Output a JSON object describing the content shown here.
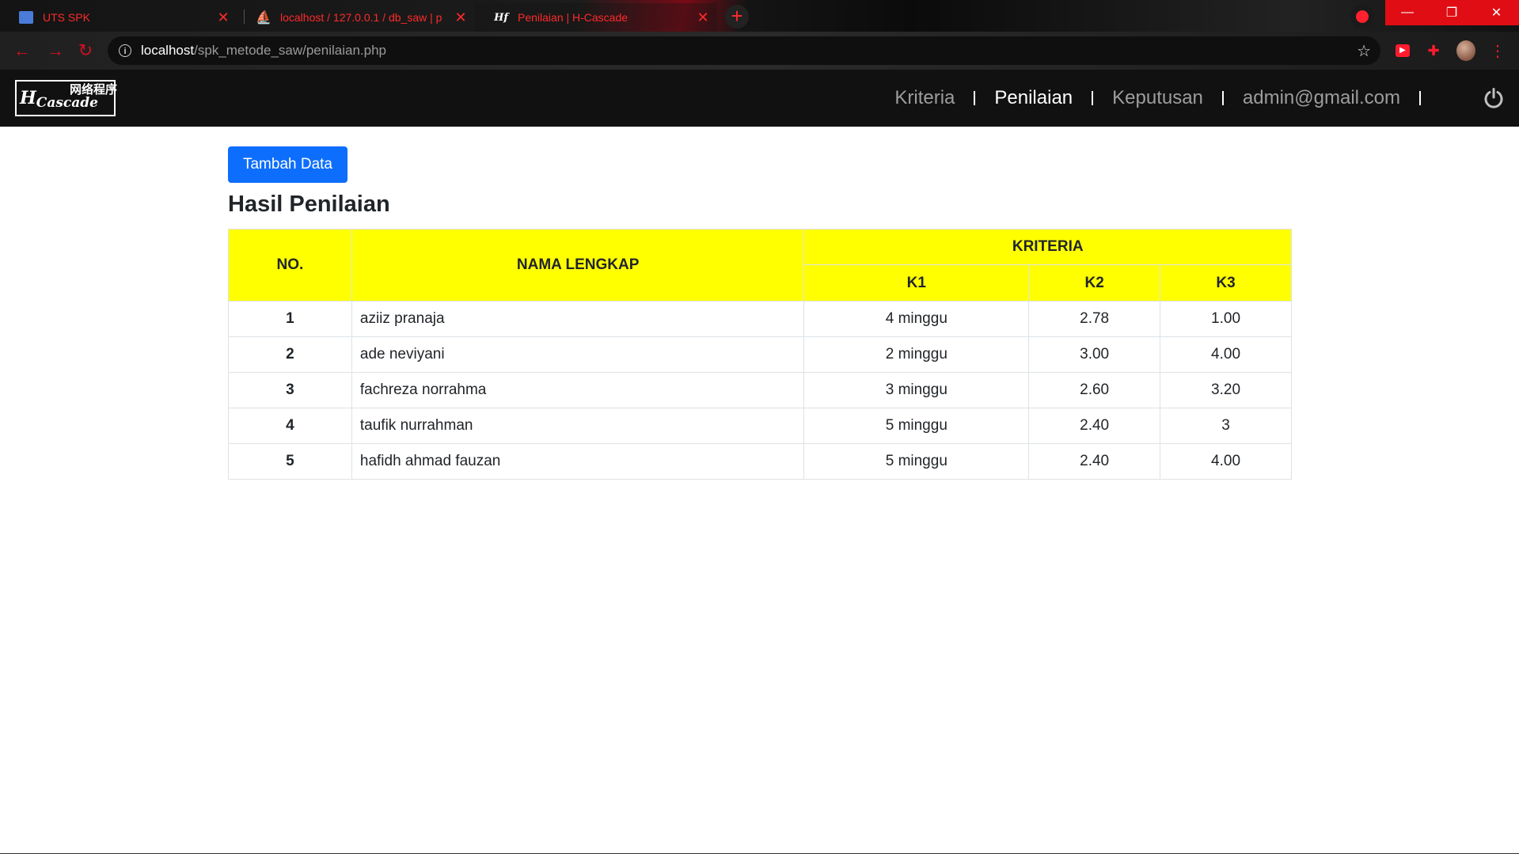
{
  "browser": {
    "tabs": [
      {
        "title": "UTS SPK",
        "favicon": "profile-icon"
      },
      {
        "title": "localhost / 127.0.0.1 / db_saw | p",
        "favicon": "phpmyadmin-icon"
      },
      {
        "title": "Penilaian | H-Cascade",
        "favicon": "hf-cascade-icon"
      }
    ],
    "url_host": "localhost",
    "url_path": "/spk_metode_saw/penilaian.php",
    "accent_color": "#ff2a2a"
  },
  "navbar": {
    "logo_text": "H Cascade",
    "logo_cn": "网络程序",
    "links": [
      {
        "label": "Kriteria",
        "active": false
      },
      {
        "label": "Penilaian",
        "active": true
      },
      {
        "label": "Keputusan",
        "active": false
      },
      {
        "label": "admin@gmail.com",
        "active": false
      }
    ]
  },
  "main": {
    "add_button": "Tambah Data",
    "title": "Hasil Penilaian",
    "table": {
      "headers": {
        "no": "NO.",
        "name": "NAMA LENGKAP",
        "criteria": "KRITERIA",
        "k1": "K1",
        "k2": "K2",
        "k3": "K3"
      },
      "header_color": "#ffff00",
      "rows": [
        {
          "no": "1",
          "name": "aziiz pranaja",
          "k1": "4 minggu",
          "k2": "2.78",
          "k3": "1.00"
        },
        {
          "no": "2",
          "name": "ade neviyani",
          "k1": "2 minggu",
          "k2": "3.00",
          "k3": "4.00"
        },
        {
          "no": "3",
          "name": "fachreza norrahma",
          "k1": "3 minggu",
          "k2": "2.60",
          "k3": "3.20"
        },
        {
          "no": "4",
          "name": "taufik nurrahman",
          "k1": "5 minggu",
          "k2": "2.40",
          "k3": "3"
        },
        {
          "no": "5",
          "name": "hafidh ahmad fauzan",
          "k1": "5 minggu",
          "k2": "2.40",
          "k3": "4.00"
        }
      ]
    }
  }
}
